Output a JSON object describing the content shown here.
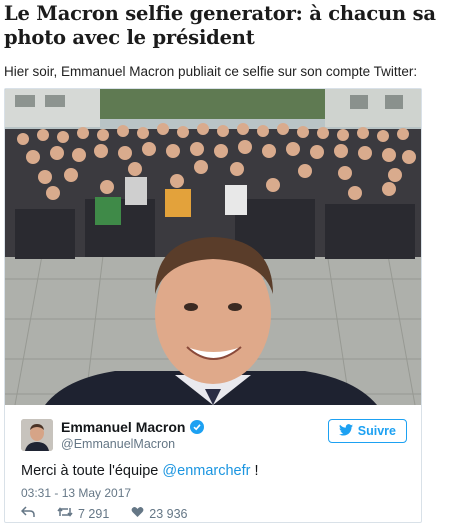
{
  "article": {
    "headline": "Le Macron selfie generator: à chacun sa photo avec le président",
    "intro": "Hier soir, Emmanuel Macron publiait ce selfie sur son compte Twitter:"
  },
  "tweet": {
    "author_name": "Emmanuel Macron",
    "author_handle": "@EmmanuelMacron",
    "follow_label": "Suivre",
    "text_before": "Merci à toute l'équipe ",
    "mention": "@enmarchefr",
    "text_after": " !",
    "timestamp": "03:31 - 13 May 2017",
    "retweet_count": "7 291",
    "like_count": "23 936"
  },
  "colors": {
    "accent": "#1da1f2",
    "mention": "#1b95e0",
    "muted": "#657786"
  },
  "icons": [
    "verified-badge-icon",
    "twitter-bird-icon",
    "reply-icon",
    "retweet-icon",
    "heart-icon"
  ]
}
